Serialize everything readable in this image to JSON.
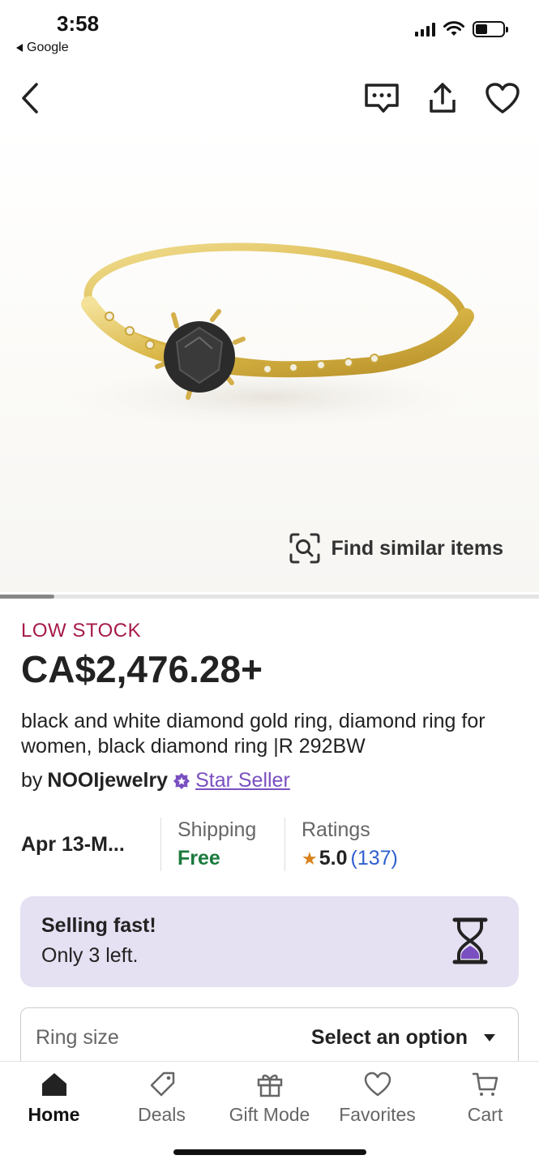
{
  "status_bar": {
    "time": "3:58",
    "back_app": "Google"
  },
  "product": {
    "stock_label": "LOW STOCK",
    "price": "CA$2,476.28+",
    "title": "black and white diamond gold ring, diamond ring for women, black diamond ring |R 292BW",
    "by": "by",
    "shop": "NOOIjewelry",
    "badge": "Star Seller"
  },
  "find_similar": "Find similar items",
  "facts": {
    "delivery": "Apr 13-M...",
    "shipping_label": "Shipping",
    "shipping_value": "Free",
    "ratings_label": "Ratings",
    "rating": "5.0",
    "rating_count": "(137)"
  },
  "selling_fast": {
    "title": "Selling fast!",
    "subtitle": "Only 3 left."
  },
  "ring_size": {
    "label": "Ring size",
    "value": "Select an option"
  },
  "tabs": [
    {
      "label": "Home",
      "icon": "home-icon"
    },
    {
      "label": "Deals",
      "icon": "tag-icon"
    },
    {
      "label": "Gift Mode",
      "icon": "gift-icon"
    },
    {
      "label": "Favorites",
      "icon": "heart-icon"
    },
    {
      "label": "Cart",
      "icon": "cart-icon"
    }
  ],
  "colors": {
    "low_stock": "#a61a4b",
    "star_seller": "#7a4fc0",
    "free": "#1a7a3c",
    "rating_count": "#2f5fcf",
    "selling_fast_bg": "#e5e0f2"
  },
  "carousel_progress": 0.1
}
